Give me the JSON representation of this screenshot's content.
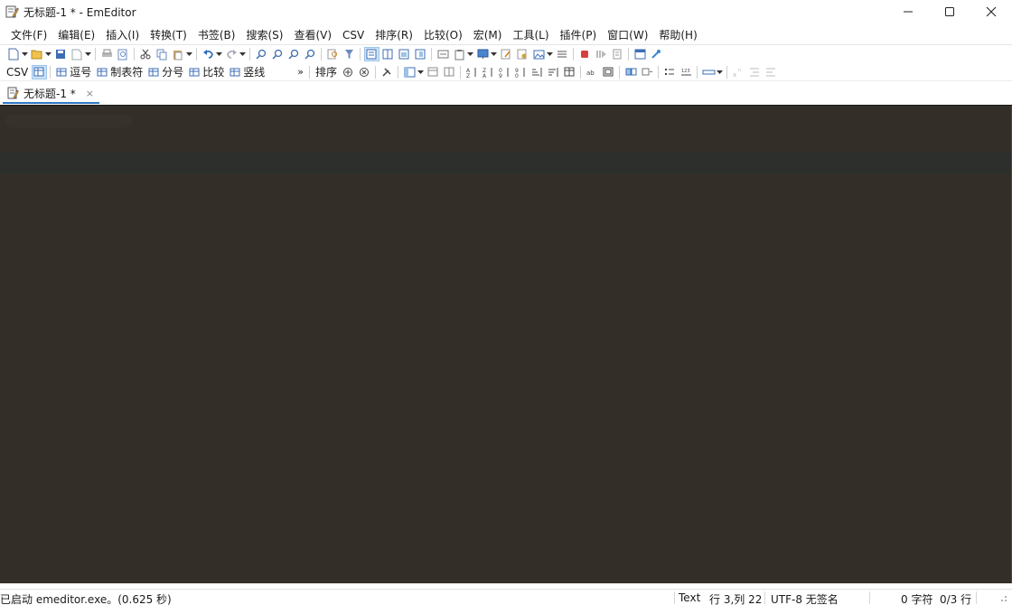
{
  "window": {
    "title": "无标题-1 * - EmEditor",
    "app_icon": "notepad-pen-icon",
    "controls": {
      "minimize": "minimize-icon",
      "maximize": "maximize-icon",
      "close": "close-icon"
    }
  },
  "menu": {
    "items": [
      "文件(F)",
      "编辑(E)",
      "插入(I)",
      "转换(T)",
      "书签(B)",
      "搜索(S)",
      "查看(V)",
      "CSV",
      "排序(R)",
      "比较(O)",
      "宏(M)",
      "工具(L)",
      "插件(P)",
      "窗口(W)",
      "帮助(H)"
    ]
  },
  "csv_toolbar": {
    "csv_label": "CSV",
    "buttons": [
      {
        "label": "逗号",
        "icon": "grid-icon"
      },
      {
        "label": "制表符",
        "icon": "grid-icon"
      },
      {
        "label": "分号",
        "icon": "grid-icon"
      },
      {
        "label": "比较",
        "icon": "grid-icon"
      },
      {
        "label": "竖线",
        "icon": "grid-icon"
      }
    ],
    "overflow": "»",
    "sort_label": "排序"
  },
  "tabs": [
    {
      "label": "无标题-1 *",
      "icon": "document-icon",
      "close": "×"
    }
  ],
  "status": {
    "message": "已启动 emeditor.exe。(0.625 秒)",
    "mode": "Text",
    "position": "行 3,列 22",
    "encoding": "UTF-8 无签名",
    "chars": "0 字符",
    "lines": "0/3 行"
  },
  "colors": {
    "editor_bg": "#332f28",
    "current_line": "#2d2f2c",
    "accent": "#2f78c4"
  }
}
